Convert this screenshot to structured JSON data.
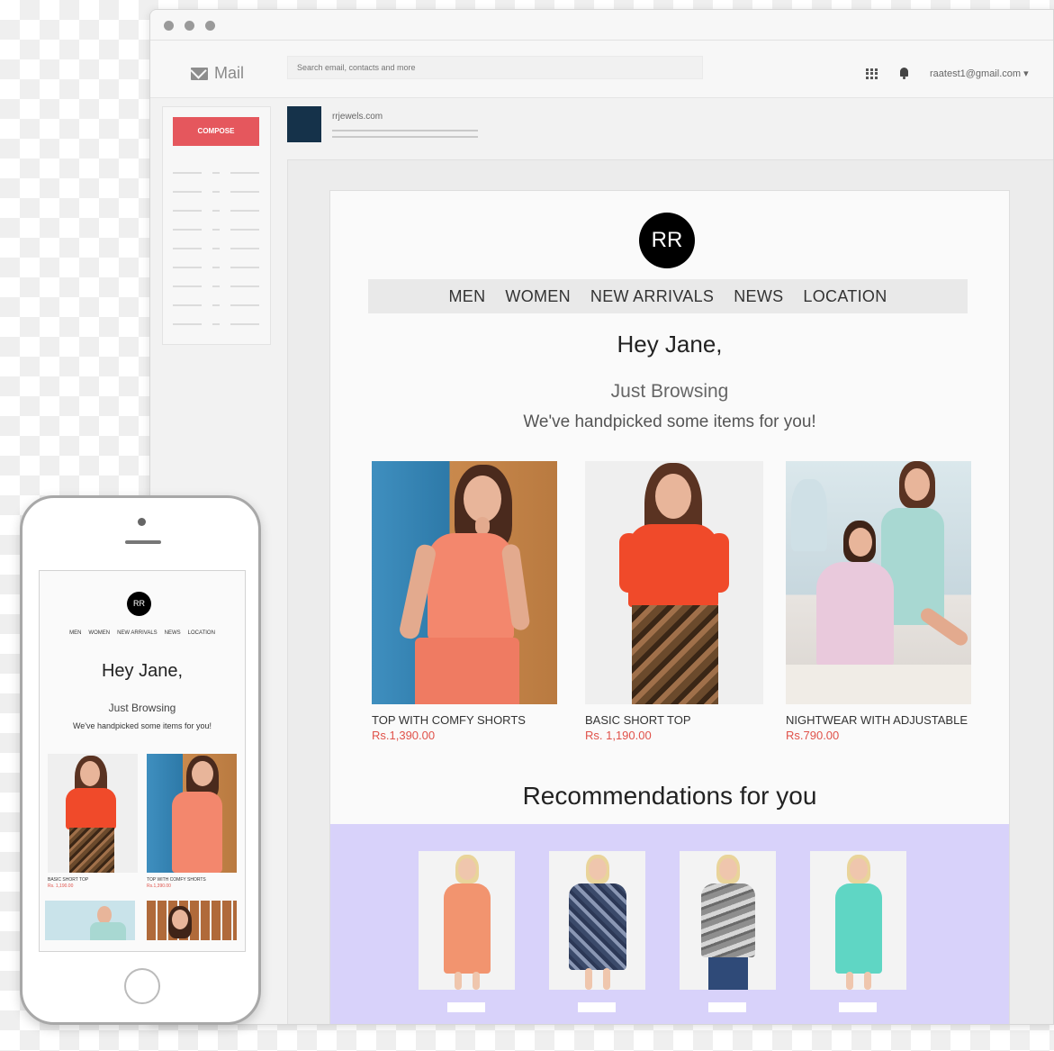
{
  "browser": {
    "app_name": "Mail",
    "search_placeholder": "Search email, contacts and more",
    "account": "raatest1@gmail.com ▾",
    "compose_label": "COMPOSE",
    "sender": "rrjewels.com"
  },
  "email": {
    "logo": "RR",
    "nav": [
      "MEN",
      "WOMEN",
      "NEW ARRIVALS",
      "NEWS",
      "LOCATION"
    ],
    "greeting": "Hey Jane,",
    "subtitle": "Just Browsing",
    "tagline": "We've handpicked some items for you!",
    "products": [
      {
        "name": "TOP WITH COMFY SHORTS",
        "price": "Rs.1,390.00"
      },
      {
        "name": "BASIC SHORT TOP",
        "price": "Rs. 1,190.00"
      },
      {
        "name": "NIGHTWEAR WITH ADJUSTABLE ...",
        "price": "Rs.790.00"
      }
    ],
    "recommendations_title": "Recommendations for you"
  },
  "mobile": {
    "logo": "RR",
    "nav": [
      "MEN",
      "WOMEN",
      "NEW ARRIVALS",
      "NEWS",
      "LOCATION"
    ],
    "greeting": "Hey Jane,",
    "subtitle": "Just Browsing",
    "tagline": "We've handpicked some items for you!",
    "products": [
      {
        "name": "BASIC SHORT TOP",
        "price": "Rs. 1,190.00"
      },
      {
        "name": "TOP WITH COMFY SHORTS",
        "price": "Rs.1,390.00"
      }
    ]
  },
  "colors": {
    "compose": "#e5575d",
    "price": "#e0524a",
    "recommendation_band": "#d8d2fa",
    "sender_avatar": "#15324a"
  }
}
